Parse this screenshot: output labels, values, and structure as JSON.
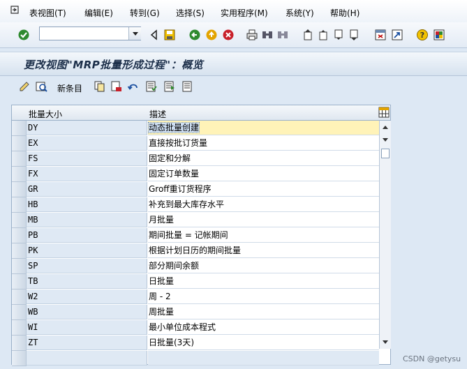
{
  "menu": [
    "表视图(T)",
    "编辑(E)",
    "转到(G)",
    "选择(S)",
    "实用程序(M)",
    "系统(Y)",
    "帮助(H)"
  ],
  "command_field": {
    "value": ""
  },
  "title": "更改视图\"MRP批量形成过程\"：概览",
  "app_toolbar": {
    "new_entries": "新条目"
  },
  "table": {
    "headers": {
      "key": "批量大小",
      "desc": "描述"
    },
    "rows": [
      {
        "key": "DY",
        "desc": "动态批量创建"
      },
      {
        "key": "EX",
        "desc": "直接按批订货量"
      },
      {
        "key": "FS",
        "desc": "固定和分解"
      },
      {
        "key": "FX",
        "desc": "固定订单数量"
      },
      {
        "key": "GR",
        "desc": "Groff重订货程序"
      },
      {
        "key": "HB",
        "desc": "补充到最大库存水平"
      },
      {
        "key": "MB",
        "desc": "月批量"
      },
      {
        "key": "PB",
        "desc": "期间批量 = 记帐期间"
      },
      {
        "key": "PK",
        "desc": "根据计划日历的期间批量"
      },
      {
        "key": "SP",
        "desc": "部分期间余额"
      },
      {
        "key": "TB",
        "desc": "日批量"
      },
      {
        "key": "W2",
        "desc": "周 - 2"
      },
      {
        "key": "WB",
        "desc": "周批量"
      },
      {
        "key": "WI",
        "desc": "最小单位成本程式"
      },
      {
        "key": "ZT",
        "desc": "日批量(3天)"
      }
    ]
  },
  "watermark": "CSDN @getysu",
  "icons": {
    "menubar": [
      "cursor-icon",
      "system-menu-icon"
    ],
    "toolbar": [
      "enter-check-icon",
      "back-triangle-icon",
      "save-icon",
      "back-icon",
      "exit-icon",
      "cancel-icon",
      "print-icon",
      "find-icon",
      "find-next-icon",
      "first-page-icon",
      "previous-page-icon",
      "next-page-icon",
      "last-page-icon",
      "create-session-icon",
      "shortcut-icon",
      "help-icon",
      "layout-icon"
    ],
    "app_toolbar": [
      "display-change-icon",
      "other-view-icon",
      "copy-icon",
      "delete-icon",
      "undo-icon",
      "select-all-icon",
      "select-block-icon",
      "deselect-all-icon"
    ],
    "table": [
      "column-config-icon"
    ]
  },
  "colors": {
    "accent": "#1c2f4a",
    "selected_row": "#fff3b8",
    "key_column": "#dfe9f4"
  }
}
